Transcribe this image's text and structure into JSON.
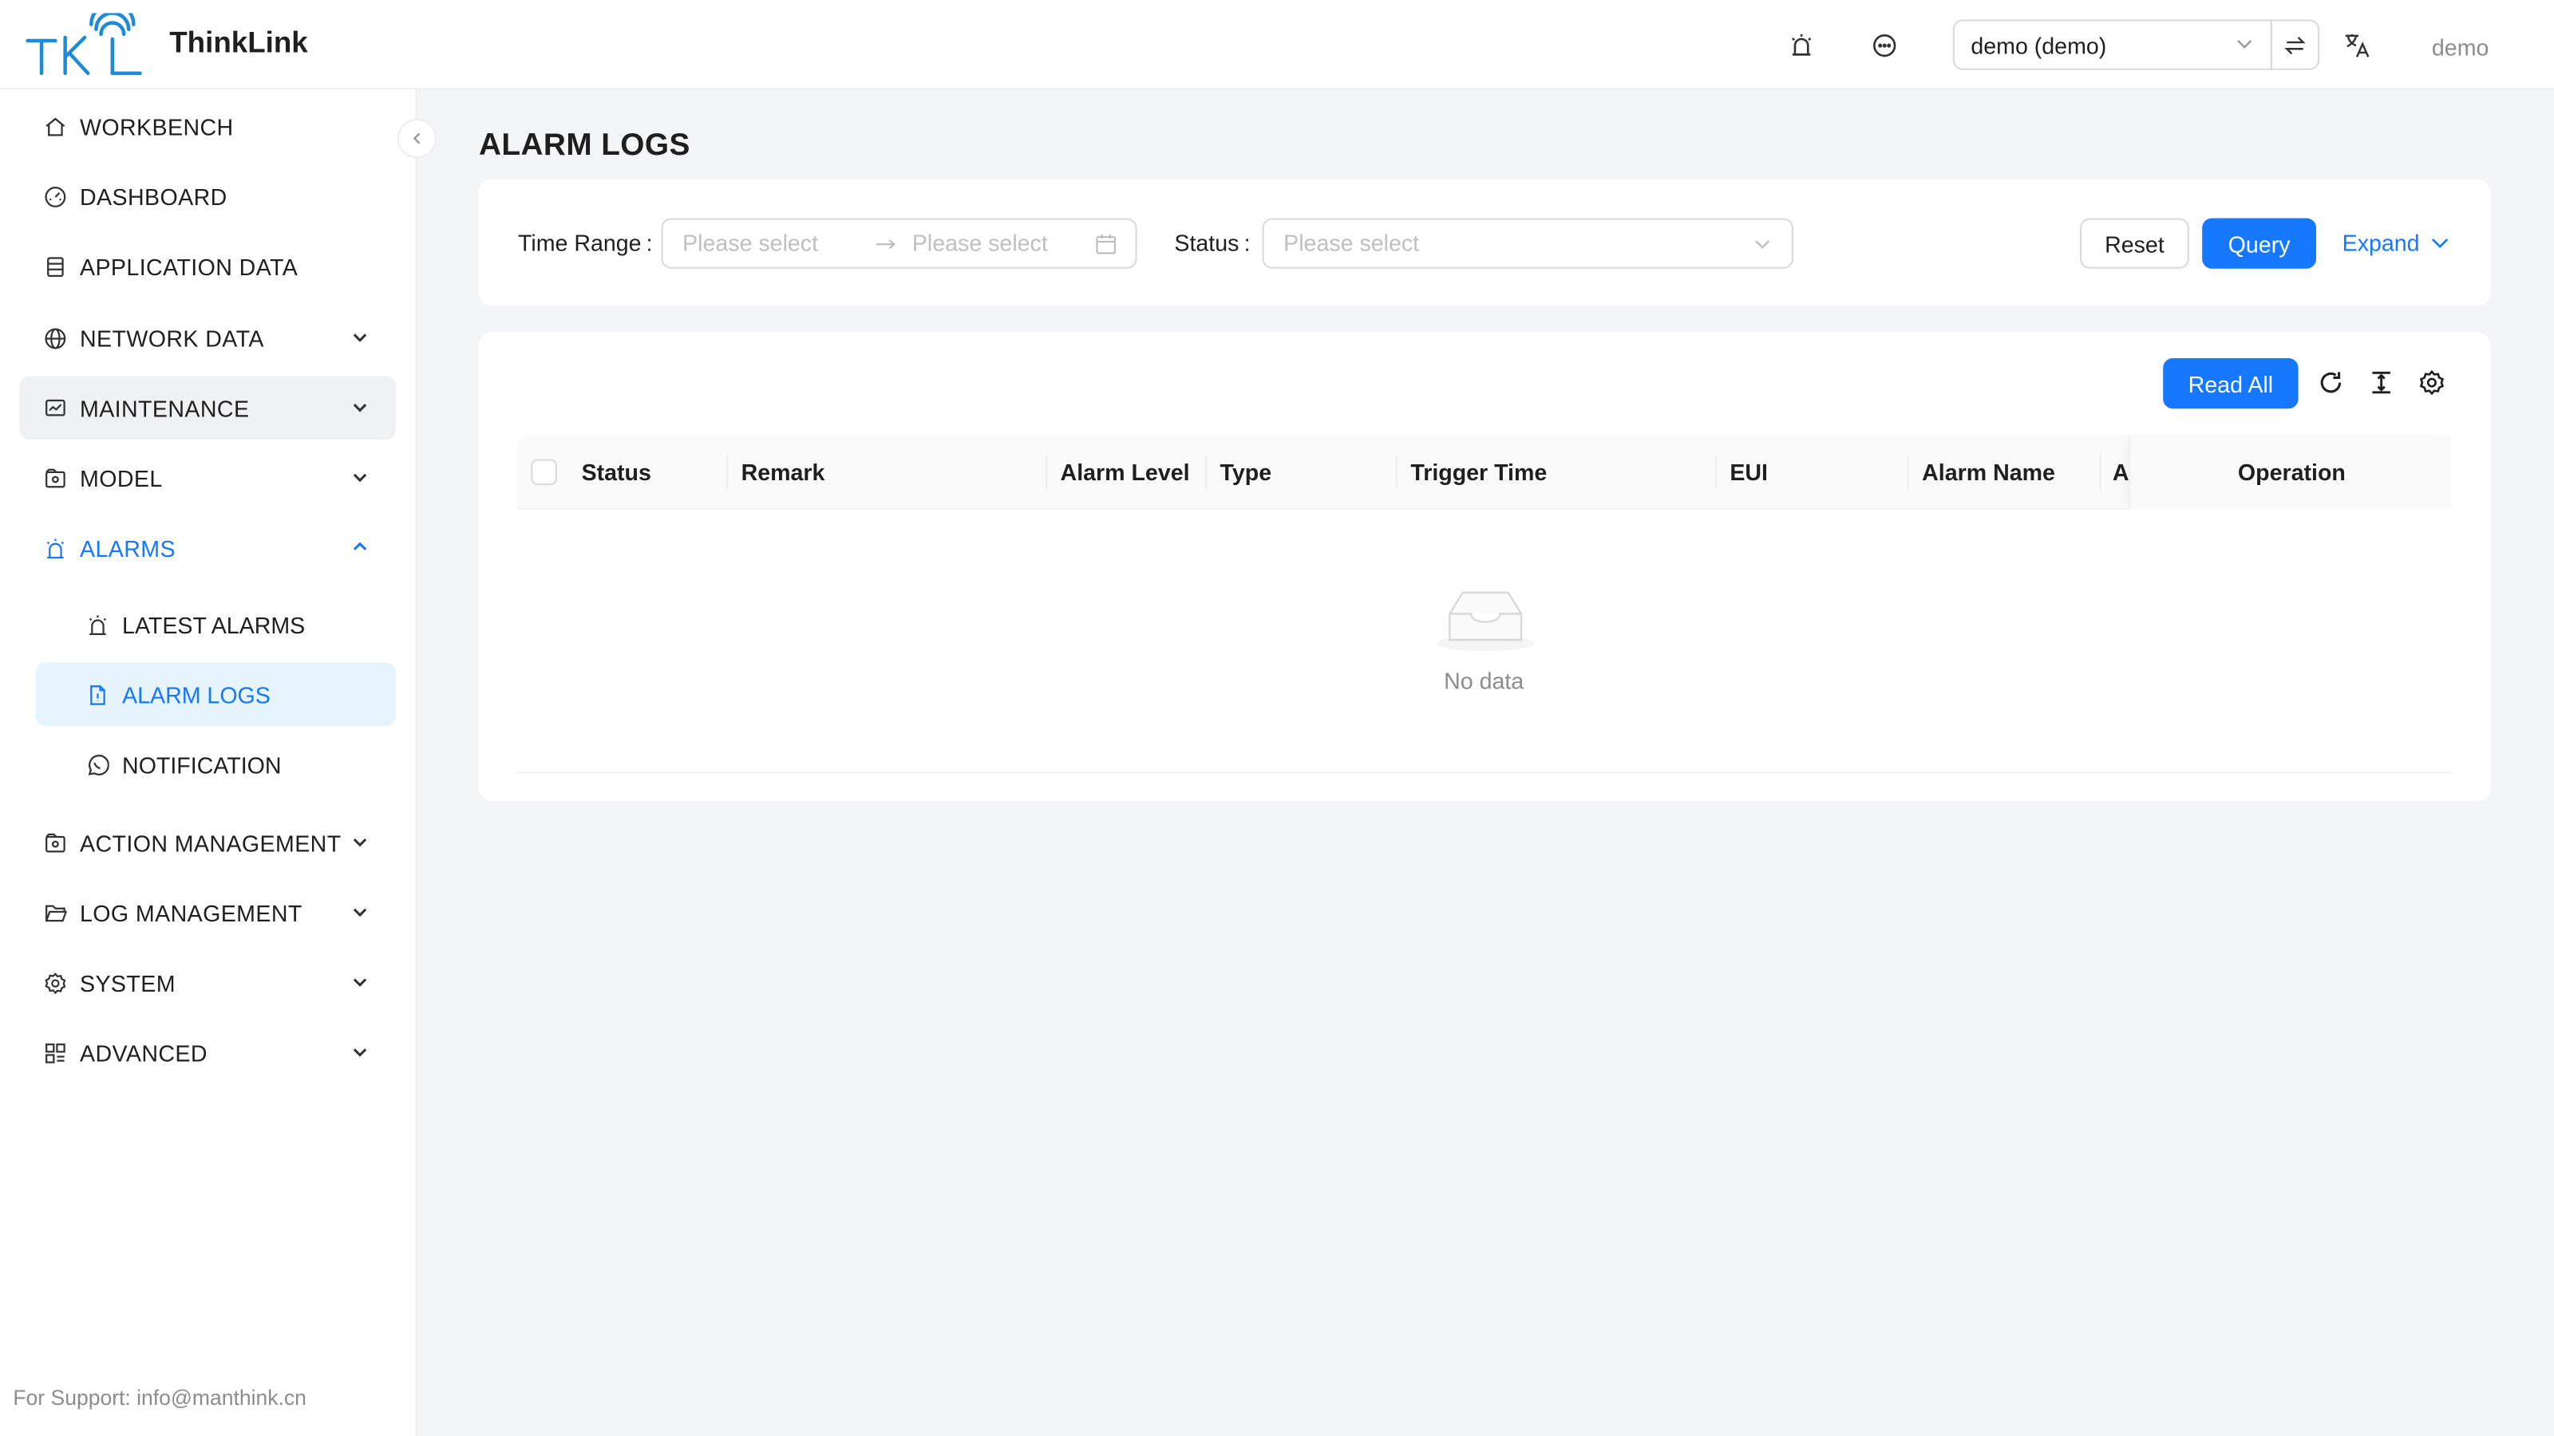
{
  "header": {
    "brand": "ThinkLink",
    "tenant_value": "demo (demo)",
    "user_name": "demo",
    "icons": [
      "alarm-bell-icon",
      "message-icon",
      "switch-icon",
      "translate-icon"
    ]
  },
  "sidebar": {
    "items": [
      {
        "label": "WORKBENCH",
        "icon": "home-icon"
      },
      {
        "label": "DASHBOARD",
        "icon": "dashboard-icon"
      },
      {
        "label": "APPLICATION DATA",
        "icon": "database-icon"
      },
      {
        "label": "NETWORK DATA",
        "icon": "globe-icon"
      },
      {
        "label": "MAINTENANCE",
        "icon": "maintenance-icon"
      },
      {
        "label": "MODEL",
        "icon": "model-icon"
      },
      {
        "label": "ALARMS",
        "icon": "alarm-icon"
      },
      {
        "label": "ACTION MANAGEMENT",
        "icon": "action-icon"
      },
      {
        "label": "LOG MANAGEMENT",
        "icon": "folder-icon"
      },
      {
        "label": "SYSTEM",
        "icon": "gear-icon"
      },
      {
        "label": "ADVANCED",
        "icon": "grid-icon"
      }
    ],
    "sub_items": [
      {
        "label": "LATEST ALARMS",
        "icon": "alarm-icon"
      },
      {
        "label": "ALARM LOGS",
        "icon": "file-icon"
      },
      {
        "label": "NOTIFICATION",
        "icon": "whatsapp-icon"
      }
    ],
    "support": "For Support: info@manthink.cn"
  },
  "main": {
    "title": "ALARM LOGS",
    "filters": {
      "time_range_label": "Time Range",
      "start_placeholder": "Please select",
      "end_placeholder": "Please select",
      "status_label": "Status",
      "status_placeholder": "Please select",
      "colon": ":"
    },
    "buttons": {
      "reset": "Reset",
      "query": "Query",
      "expand": "Expand",
      "read_all": "Read All"
    },
    "table": {
      "columns": [
        "Status",
        "Remark",
        "Alarm Level",
        "Type",
        "Trigger Time",
        "EUI",
        "Alarm Name",
        "Al",
        "Operation"
      ],
      "empty_text": "No data"
    }
  },
  "colors": {
    "primary": "#1677ff",
    "selected_bg": "#e6f4ff",
    "page_bg": "#f4f5f7"
  }
}
